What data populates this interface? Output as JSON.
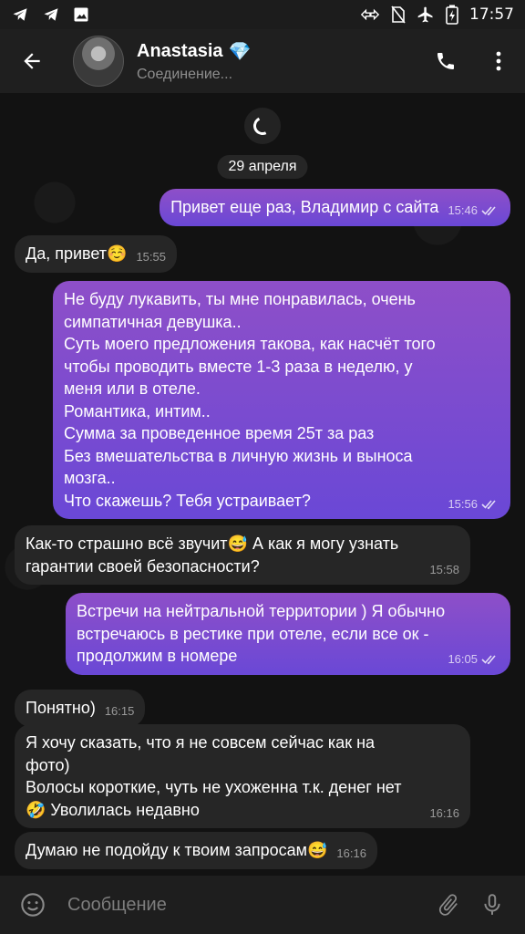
{
  "status_bar": {
    "time": "17:57",
    "left_icons": [
      "telegram-icon",
      "telegram-icon",
      "image-icon"
    ],
    "right_icons": [
      "data-saver-icon",
      "no-sim-icon",
      "airplane-icon",
      "battery-charging-icon"
    ]
  },
  "header": {
    "name": "Anastasia",
    "badge": "💎",
    "status": "Соединение...",
    "icons": [
      "back-arrow-icon",
      "phone-icon",
      "more-vert-icon"
    ]
  },
  "chat": {
    "date": "29 апреля",
    "messages": [
      {
        "direction": "out",
        "text": "Привет еще раз, Владимир с сайта",
        "time": "15:46",
        "read": true
      },
      {
        "direction": "in",
        "text": "Да, привет☺️",
        "time": "15:55"
      },
      {
        "direction": "out",
        "text": "Не буду лукавить, ты мне понравилась, очень\nсимпатичная девушка..\nСуть моего предложения такова, как насчёт того\nчтобы проводить вместе 1-3 раза в неделю, у\nменя или в отеле.\nРомантика, интим..\nСумма за проведенное время 25т за раз\nБез вмешательства в личную жизнь и выноса\nмозга..\nЧто скажешь? Тебя устраивает?",
        "time": "15:56",
        "read": true
      },
      {
        "direction": "in",
        "text": "Как-то страшно всё звучит😅 А как я могу узнать\nгарантии своей безопасности?",
        "time": "15:58"
      },
      {
        "direction": "out",
        "text": "Встречи на нейтральной территории ) Я обычно\nвстречаюсь в рестике при отеле, если все ок -\nпродолжим в номере",
        "time": "16:05",
        "read": true
      },
      {
        "direction": "in",
        "text": "Понятно)",
        "time": "16:15"
      },
      {
        "direction": "in",
        "text": "Я хочу сказать, что я не совсем сейчас как на\nфото)\nВолосы короткие, чуть не ухоженна т.к. денег нет\n🤣 Уволилась недавно",
        "time": "16:16"
      },
      {
        "direction": "in",
        "text": "Думаю не подойду к твоим запросам😅",
        "time": "16:16"
      }
    ]
  },
  "composer": {
    "placeholder": "Сообщение",
    "icons": [
      "emoji-icon",
      "attach-icon",
      "mic-icon"
    ]
  },
  "colors": {
    "outgoing_top": "#8e4fc8",
    "outgoing_bottom": "#6a48d6",
    "incoming": "#262626",
    "background": "#121212"
  }
}
